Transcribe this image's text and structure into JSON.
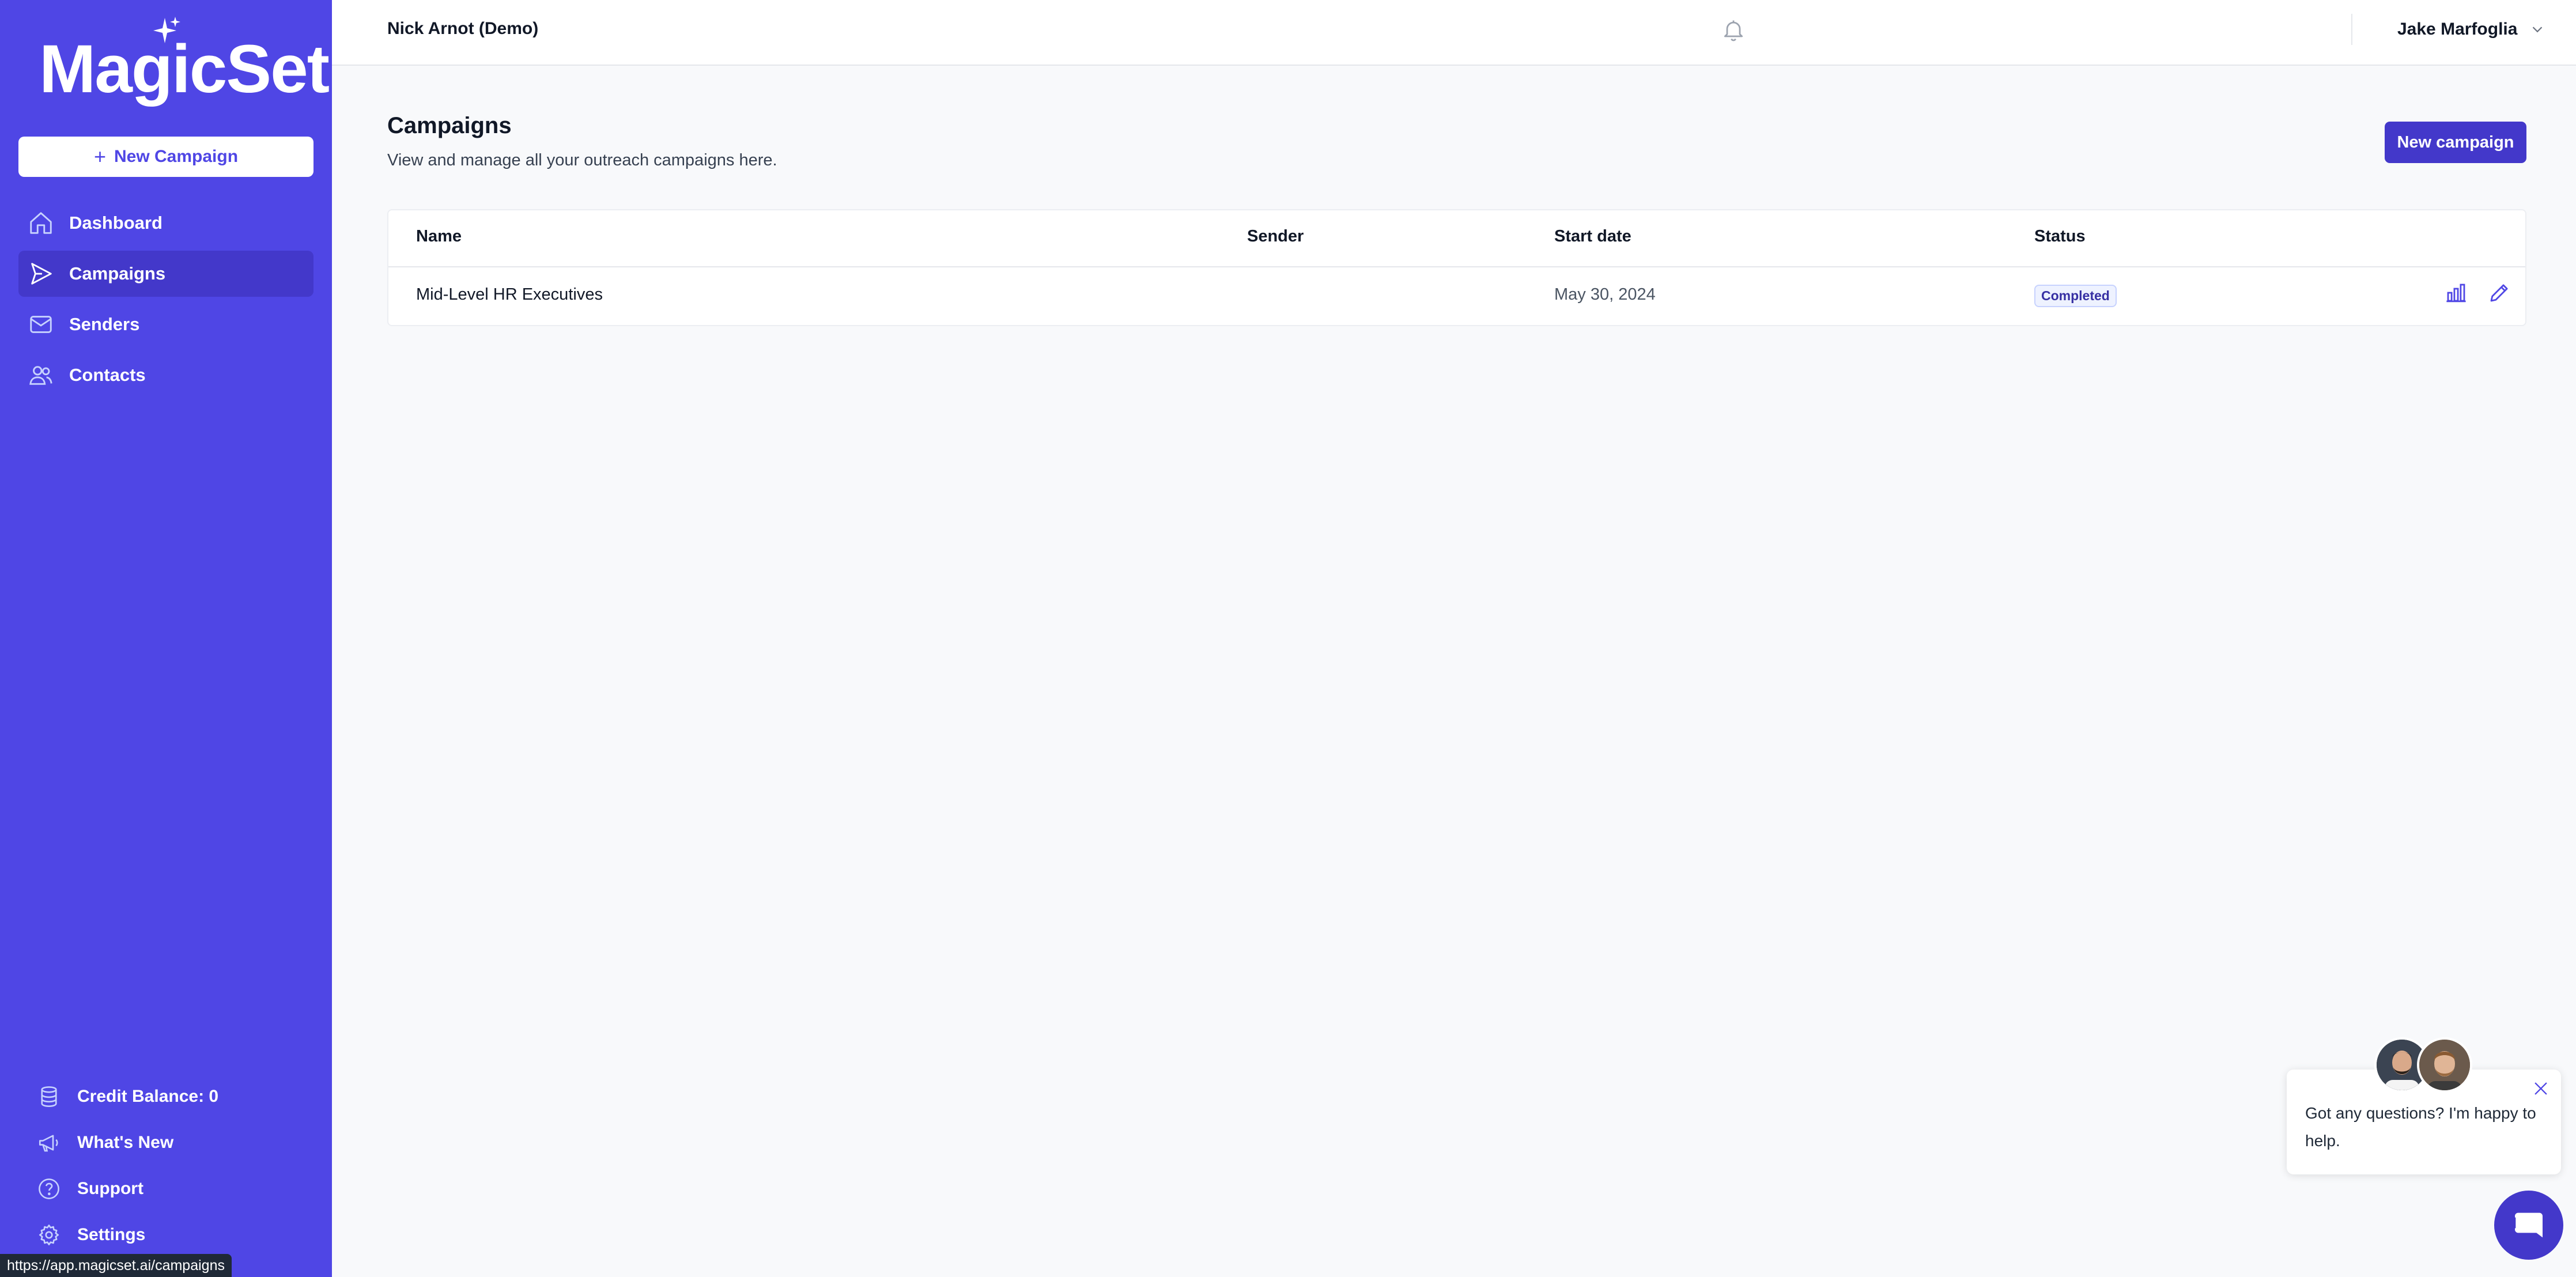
{
  "brand": {
    "name": "MagicSet"
  },
  "sidebar": {
    "new_campaign_label": "New Campaign",
    "items": [
      {
        "label": "Dashboard",
        "icon": "home-icon",
        "active": false
      },
      {
        "label": "Campaigns",
        "icon": "send-icon",
        "active": true
      },
      {
        "label": "Senders",
        "icon": "mail-icon",
        "active": false
      },
      {
        "label": "Contacts",
        "icon": "users-icon",
        "active": false
      }
    ],
    "bottom": {
      "credit_balance": "Credit Balance: 0",
      "whats_new": "What's New",
      "support": "Support",
      "settings": "Settings"
    }
  },
  "status_url": "https://app.magicset.ai/campaigns",
  "header": {
    "org_name": "Nick Arnot (Demo)",
    "user_name": "Jake Marfoglia"
  },
  "main": {
    "title": "Campaigns",
    "subtitle": "View and manage all your outreach campaigns here.",
    "new_campaign_label": "New campaign"
  },
  "table": {
    "columns": [
      "Name",
      "Sender",
      "Start date",
      "Status"
    ],
    "rows": [
      {
        "name": "Mid-Level HR Executives",
        "sender": "",
        "start_date": "May 30, 2024",
        "status": "Completed"
      }
    ]
  },
  "chat": {
    "message": "Got any questions? I'm happy to help."
  },
  "colors": {
    "primary": "#4f46e5",
    "primary_dark": "#4338ca",
    "background": "#f8f9fb"
  }
}
